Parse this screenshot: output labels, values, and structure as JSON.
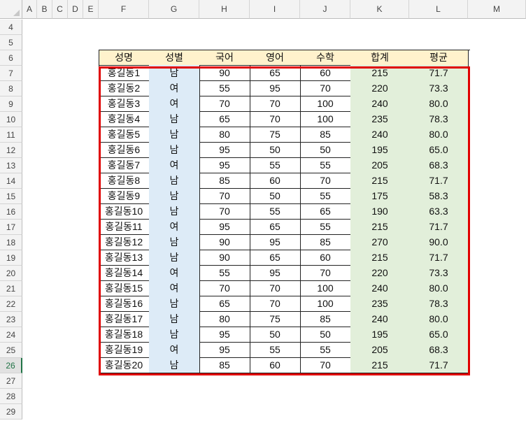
{
  "columns": [
    "A",
    "B",
    "C",
    "D",
    "E",
    "F",
    "G",
    "H",
    "I",
    "J",
    "K",
    "L",
    "M"
  ],
  "rows": [
    "4",
    "5",
    "6",
    "7",
    "8",
    "9",
    "10",
    "11",
    "12",
    "13",
    "14",
    "15",
    "16",
    "17",
    "18",
    "19",
    "20",
    "21",
    "22",
    "23",
    "24",
    "25",
    "26",
    "27",
    "28",
    "29"
  ],
  "active_row": "26",
  "table": {
    "headers": [
      "성명",
      "성별",
      "국어",
      "영어",
      "수학",
      "합계",
      "평균"
    ],
    "records": [
      [
        "홍길동1",
        "남",
        "90",
        "65",
        "60",
        "215",
        "71.7"
      ],
      [
        "홍길동2",
        "여",
        "55",
        "95",
        "70",
        "220",
        "73.3"
      ],
      [
        "홍길동3",
        "여",
        "70",
        "70",
        "100",
        "240",
        "80.0"
      ],
      [
        "홍길동4",
        "남",
        "65",
        "70",
        "100",
        "235",
        "78.3"
      ],
      [
        "홍길동5",
        "남",
        "80",
        "75",
        "85",
        "240",
        "80.0"
      ],
      [
        "홍길동6",
        "남",
        "95",
        "50",
        "50",
        "195",
        "65.0"
      ],
      [
        "홍길동7",
        "여",
        "95",
        "55",
        "55",
        "205",
        "68.3"
      ],
      [
        "홍길동8",
        "남",
        "85",
        "60",
        "70",
        "215",
        "71.7"
      ],
      [
        "홍길동9",
        "남",
        "70",
        "50",
        "55",
        "175",
        "58.3"
      ],
      [
        "홍길동10",
        "남",
        "70",
        "55",
        "65",
        "190",
        "63.3"
      ],
      [
        "홍길동11",
        "여",
        "95",
        "65",
        "55",
        "215",
        "71.7"
      ],
      [
        "홍길동12",
        "남",
        "90",
        "95",
        "85",
        "270",
        "90.0"
      ],
      [
        "홍길동13",
        "남",
        "90",
        "65",
        "60",
        "215",
        "71.7"
      ],
      [
        "홍길동14",
        "여",
        "55",
        "95",
        "70",
        "220",
        "73.3"
      ],
      [
        "홍길동15",
        "여",
        "70",
        "70",
        "100",
        "240",
        "80.0"
      ],
      [
        "홍길동16",
        "남",
        "65",
        "70",
        "100",
        "235",
        "78.3"
      ],
      [
        "홍길동17",
        "남",
        "80",
        "75",
        "85",
        "240",
        "80.0"
      ],
      [
        "홍길동18",
        "남",
        "95",
        "50",
        "50",
        "195",
        "65.0"
      ],
      [
        "홍길동19",
        "여",
        "95",
        "55",
        "55",
        "205",
        "68.3"
      ],
      [
        "홍길동20",
        "남",
        "85",
        "60",
        "70",
        "215",
        "71.7"
      ]
    ]
  },
  "colors": {
    "header_fill": "#fff2cc",
    "gender_fill": "#ddebf7",
    "total_avg_fill": "#e2efda",
    "selection_border": "#e00000",
    "active_row_accent": "#217346"
  }
}
